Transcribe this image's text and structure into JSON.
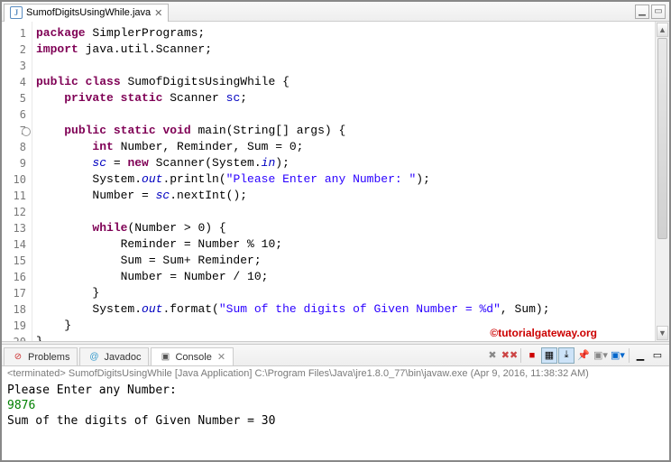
{
  "editor": {
    "tab_title": "SumofDigitsUsingWhile.java",
    "lines": [
      1,
      2,
      3,
      4,
      5,
      6,
      7,
      8,
      9,
      10,
      11,
      12,
      13,
      14,
      15,
      16,
      17,
      18,
      19,
      20
    ]
  },
  "code": {
    "l1a": "package",
    "l1b": " SimplerPrograms;",
    "l2a": "import",
    "l2b": " java.util.Scanner;",
    "l4a": "public",
    "l4b": " ",
    "l4c": "class",
    "l4d": " SumofDigitsUsingWhile {",
    "l5a": "    ",
    "l5b": "private",
    "l5c": " ",
    "l5d": "static",
    "l5e": " Scanner ",
    "l5f": "sc",
    "l5g": ";",
    "l7a": "    ",
    "l7b": "public",
    "l7c": " ",
    "l7d": "static",
    "l7e": " ",
    "l7f": "void",
    "l7g": " main(String[] args) {",
    "l8a": "        ",
    "l8b": "int",
    "l8c": " Number, Reminder, Sum = 0;",
    "l9a": "        ",
    "l9b": "sc",
    "l9c": " = ",
    "l9d": "new",
    "l9e": " Scanner(System.",
    "l9f": "in",
    "l9g": ");",
    "l10a": "        System.",
    "l10b": "out",
    "l10c": ".println(",
    "l10d": "\"Please Enter any Number: \"",
    "l10e": ");",
    "l11a": "        Number = ",
    "l11b": "sc",
    "l11c": ".nextInt();",
    "l13a": "        ",
    "l13b": "while",
    "l13c": "(Number > 0) {",
    "l14": "            Reminder = Number % 10;",
    "l15": "            Sum = Sum+ Reminder;",
    "l16": "            Number = Number / 10;",
    "l17": "        }",
    "l18a": "        System.",
    "l18b": "out",
    "l18c": ".format(",
    "l18d": "\"Sum of the digits of Given Number = %d\"",
    "l18e": ", Sum);",
    "l19": "    }",
    "l20": "}"
  },
  "watermark": "©tutorialgateway.org",
  "bottom": {
    "tab_problems": "Problems",
    "tab_javadoc": "Javadoc",
    "tab_console": "Console",
    "status": "<terminated> SumofDigitsUsingWhile [Java Application] C:\\Program Files\\Java\\jre1.8.0_77\\bin\\javaw.exe (Apr 9, 2016, 11:38:32 AM)",
    "line1": "Please Enter any Number: ",
    "line2": "9876",
    "line3": "Sum of the digits of Given Number = 30"
  }
}
